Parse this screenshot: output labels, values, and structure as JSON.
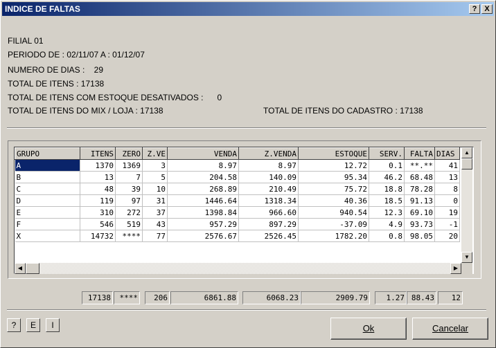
{
  "window": {
    "title": "INDICE DE FALTAS",
    "help_btn": "?",
    "close_btn": "X"
  },
  "info": {
    "filial": "FILIAL 01",
    "periodo": "PERIODO DE : 02/11/07 A : 01/12/07",
    "numero_dias": "NUMERO DE DIAS :    29",
    "total_itens": "TOTAL DE ITENS : 17138",
    "total_desativados": "TOTAL DE ITENS COM ESTOQUE DESATIVADOS :      0",
    "total_mix": "TOTAL DE ITENS DO MIX / LOJA : 17138",
    "total_cadastro": "TOTAL DE ITENS DO CADASTRO : 17138"
  },
  "table": {
    "headers": [
      "GRUPO",
      "ITENS",
      "ZERO",
      "Z.VE",
      "VENDA",
      "Z.VENDA",
      "ESTOQUE",
      "SERV.",
      "FALTA",
      "DIAS"
    ],
    "rows": [
      [
        "A",
        "1370",
        "1369",
        "3",
        "8.97",
        "8.97",
        "12.72",
        "0.1",
        "**.**",
        "41"
      ],
      [
        "B",
        "13",
        "7",
        "5",
        "204.58",
        "140.09",
        "95.34",
        "46.2",
        "68.48",
        "13"
      ],
      [
        "C",
        "48",
        "39",
        "10",
        "268.89",
        "210.49",
        "75.72",
        "18.8",
        "78.28",
        "8"
      ],
      [
        "D",
        "119",
        "97",
        "31",
        "1446.64",
        "1318.34",
        "40.36",
        "18.5",
        "91.13",
        "0"
      ],
      [
        "E",
        "310",
        "272",
        "37",
        "1398.84",
        "966.60",
        "940.54",
        "12.3",
        "69.10",
        "19"
      ],
      [
        "F",
        "546",
        "519",
        "43",
        "957.29",
        "897.29",
        "-37.09",
        "4.9",
        "93.73",
        "-1"
      ],
      [
        "X",
        "14732",
        "****",
        "77",
        "2576.67",
        "2526.45",
        "1782.20",
        "0.8",
        "98.05",
        "20"
      ]
    ]
  },
  "totals": [
    "17138",
    "****",
    "206",
    "6861.88",
    "6068.23",
    "2909.79",
    "1.27",
    "88.43",
    "12"
  ],
  "buttons": {
    "help": "?",
    "e": "E",
    "i": "I",
    "ok": "Ok",
    "cancel": "Cancelar"
  }
}
